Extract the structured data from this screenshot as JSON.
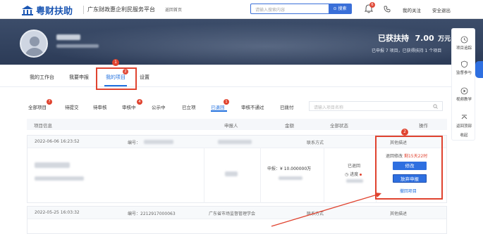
{
  "header": {
    "logo_text": "粤财扶助",
    "platform": "广东财政惠企利民服务平台",
    "back_home": "返回首页",
    "search_placeholder": "请输入搜索内容",
    "search_button": "⊙ 搜索",
    "notification_count": "6",
    "links": [
      "我的关注",
      "安全退出"
    ]
  },
  "banner": {
    "support_label": "已获扶持",
    "support_value": "7.00",
    "support_unit": "万元",
    "support_sub": "已申报 7 项目，已获得扶持 1 个项目"
  },
  "main_tabs": {
    "items": [
      "我的工作台",
      "我要申报",
      "我的项目",
      "设置"
    ],
    "active": "我的项目",
    "step1_badge": "1",
    "step1_tab_badge": "2"
  },
  "project_tabs": {
    "items": [
      {
        "label": "全部项目",
        "badge": "7"
      },
      {
        "label": "待提交",
        "badge": ""
      },
      {
        "label": "待审核",
        "badge": ""
      },
      {
        "label": "审核中",
        "badge": "4"
      },
      {
        "label": "公示中",
        "badge": ""
      },
      {
        "label": "已立项",
        "badge": ""
      },
      {
        "label": "已退回",
        "badge": "1"
      },
      {
        "label": "审核不通过",
        "badge": ""
      },
      {
        "label": "已拨付",
        "badge": ""
      }
    ],
    "active": "已退回",
    "search_placeholder": "请输入项目名称"
  },
  "table": {
    "headers": [
      "项目信息",
      "申报人",
      "金额",
      "全部状态",
      "操作"
    ]
  },
  "cards": [
    {
      "date": "2022-06-06 16:23:52",
      "number_label": "编号：",
      "contact": "联系方式",
      "other_desc": "其他描述",
      "apply_label": "申报：",
      "apply_amount": "¥ 10.000000万",
      "status": "已退回",
      "progress": "进度",
      "remain_label": "退回修改",
      "remain_value": "剩15天22时",
      "button_edit": "修改",
      "button_abandon": "放弃申报",
      "link_withdraw": "撤回项目",
      "step2_badge": "2"
    },
    {
      "date": "2022-05-25 16:03:32",
      "number_label": "编号：",
      "number_value": "2212917000063",
      "org": "广东省市场监督管理学会",
      "contact": "联系方式",
      "other_desc": "其他描述"
    }
  ],
  "right_sidebar": {
    "items": [
      "项目追踪",
      "监督参与",
      "视频教学",
      "返回顶部",
      "收起"
    ]
  },
  "colors": {
    "brand": "#1b56b3",
    "accent": "#2e6fe0",
    "highlight": "#e0432f",
    "banner": "#2c3b57"
  }
}
